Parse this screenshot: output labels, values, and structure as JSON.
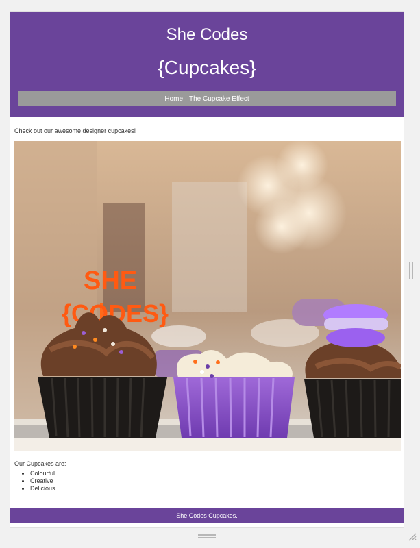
{
  "header": {
    "title": "She Codes",
    "subtitle": "{Cupcakes}"
  },
  "nav": {
    "items": [
      {
        "label": "Home"
      },
      {
        "label": "The Cupcake Effect"
      }
    ]
  },
  "main": {
    "intro": "Check out our awesome designer cupcakes!",
    "image_alt": "She Codes cupcakes",
    "topper_line1": "SHE",
    "topper_line2": "{CODES}",
    "list_heading": "Our Cupcakes are:",
    "list_items": [
      "Colourful",
      "Creative",
      "Delicious"
    ]
  },
  "footer": {
    "text": "She Codes Cupcakes."
  },
  "colors": {
    "brand_purple": "#6a449a",
    "nav_gray": "#9a9a9a",
    "background": "#f1f1f1"
  },
  "icons": {
    "bottom_resize": "horizontal-resize-grip-icon",
    "side_resize": "vertical-resize-grip-icon",
    "corner_resize": "corner-resize-grip-icon"
  }
}
